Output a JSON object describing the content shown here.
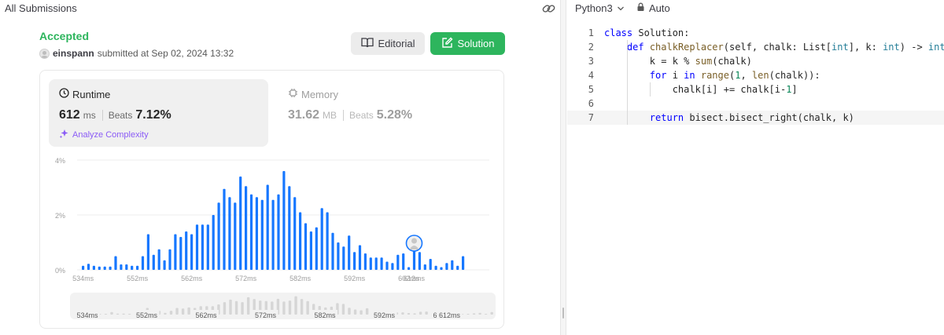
{
  "header": {
    "title": "All Submissions"
  },
  "submission": {
    "status": "Accepted",
    "user": "einspann",
    "submitted_text": "submitted at Sep 02, 2024 13:32"
  },
  "buttons": {
    "editorial": "Editorial",
    "solution": "Solution"
  },
  "runtime": {
    "label": "Runtime",
    "value": "612",
    "unit": "ms",
    "beats_label": "Beats",
    "beats_value": "7.12%",
    "analyze": "Analyze Complexity"
  },
  "memory": {
    "label": "Memory",
    "value": "31.62",
    "unit": "MB",
    "beats_label": "Beats",
    "beats_value": "5.28%"
  },
  "editor": {
    "language": "Python3",
    "mode": "Auto"
  },
  "code_lines": [
    {
      "num": "1",
      "tokens": [
        [
          "kw",
          "class"
        ],
        [
          "t",
          " Solution:"
        ]
      ]
    },
    {
      "num": "2",
      "tokens": [
        [
          "t",
          "    "
        ],
        [
          "kw",
          "def"
        ],
        [
          "t",
          " "
        ],
        [
          "fn",
          "chalkReplacer"
        ],
        [
          "t",
          "(self, chalk: List["
        ],
        [
          "ty",
          "int"
        ],
        [
          "t",
          "], k: "
        ],
        [
          "ty",
          "int"
        ],
        [
          "t",
          ") -> "
        ],
        [
          "ty",
          "int"
        ],
        [
          "t",
          ":"
        ]
      ]
    },
    {
      "num": "3",
      "tokens": [
        [
          "t",
          "        k = k % "
        ],
        [
          "fn",
          "sum"
        ],
        [
          "t",
          "(chalk)"
        ]
      ]
    },
    {
      "num": "4",
      "tokens": [
        [
          "t",
          "        "
        ],
        [
          "kw",
          "for"
        ],
        [
          "t",
          " i "
        ],
        [
          "kw",
          "in"
        ],
        [
          "t",
          " "
        ],
        [
          "fn",
          "range"
        ],
        [
          "t",
          "("
        ],
        [
          "num",
          "1"
        ],
        [
          "t",
          ", "
        ],
        [
          "fn",
          "len"
        ],
        [
          "t",
          "(chalk)):"
        ]
      ]
    },
    {
      "num": "5",
      "tokens": [
        [
          "t",
          "            chalk[i] += chalk[i-"
        ],
        [
          "num",
          "1"
        ],
        [
          "t",
          "]"
        ]
      ]
    },
    {
      "num": "6",
      "tokens": []
    },
    {
      "num": "7",
      "tokens": [
        [
          "t",
          "        "
        ],
        [
          "kw",
          "return"
        ],
        [
          "t",
          " bisect.bisect_right(chalk, k)"
        ]
      ]
    }
  ],
  "colors": {
    "accepted": "#2db55d",
    "bar": "#1677ff",
    "bar_faded": "#b9d4fb",
    "nav_bar": "#d6d6d6",
    "analyze": "#8b5cf6"
  },
  "chart_data": {
    "type": "bar",
    "ylabel_ticks": [
      "0%",
      "2%",
      "4%"
    ],
    "ylim": [
      0,
      4
    ],
    "x_tick_labels": [
      "534ms",
      "552ms",
      "562ms",
      "572ms",
      "582ms",
      "592ms",
      "602ms",
      "612ms"
    ],
    "values": [
      0.15,
      0.22,
      0.15,
      0.12,
      0.12,
      0.12,
      0.5,
      0.2,
      0.2,
      0.15,
      0.15,
      0.5,
      1.3,
      0.55,
      0.75,
      0.35,
      0.75,
      1.3,
      1.2,
      1.4,
      1.3,
      1.65,
      1.65,
      1.65,
      2.0,
      2.45,
      2.95,
      2.65,
      2.45,
      3.4,
      3.05,
      2.75,
      2.65,
      2.55,
      3.1,
      2.55,
      2.75,
      3.6,
      3.05,
      2.65,
      2.1,
      1.7,
      1.4,
      1.55,
      2.25,
      2.1,
      1.35,
      1.0,
      0.85,
      1.25,
      0.65,
      0.9,
      0.6,
      0.45,
      0.45,
      0.45,
      0.3,
      0.25,
      0.55,
      0.6,
      0.1,
      0.8,
      0.65,
      0.2,
      0.4,
      0.15,
      0.1,
      0.25,
      0.35,
      0.15,
      0.5
    ],
    "highlight_index": 61,
    "highlight_label": "612ms",
    "navigator_ticks": [
      "534ms",
      "552ms",
      "562ms",
      "572ms",
      "582ms",
      "592ms",
      "602ms",
      "612ms"
    ],
    "grid": true
  }
}
